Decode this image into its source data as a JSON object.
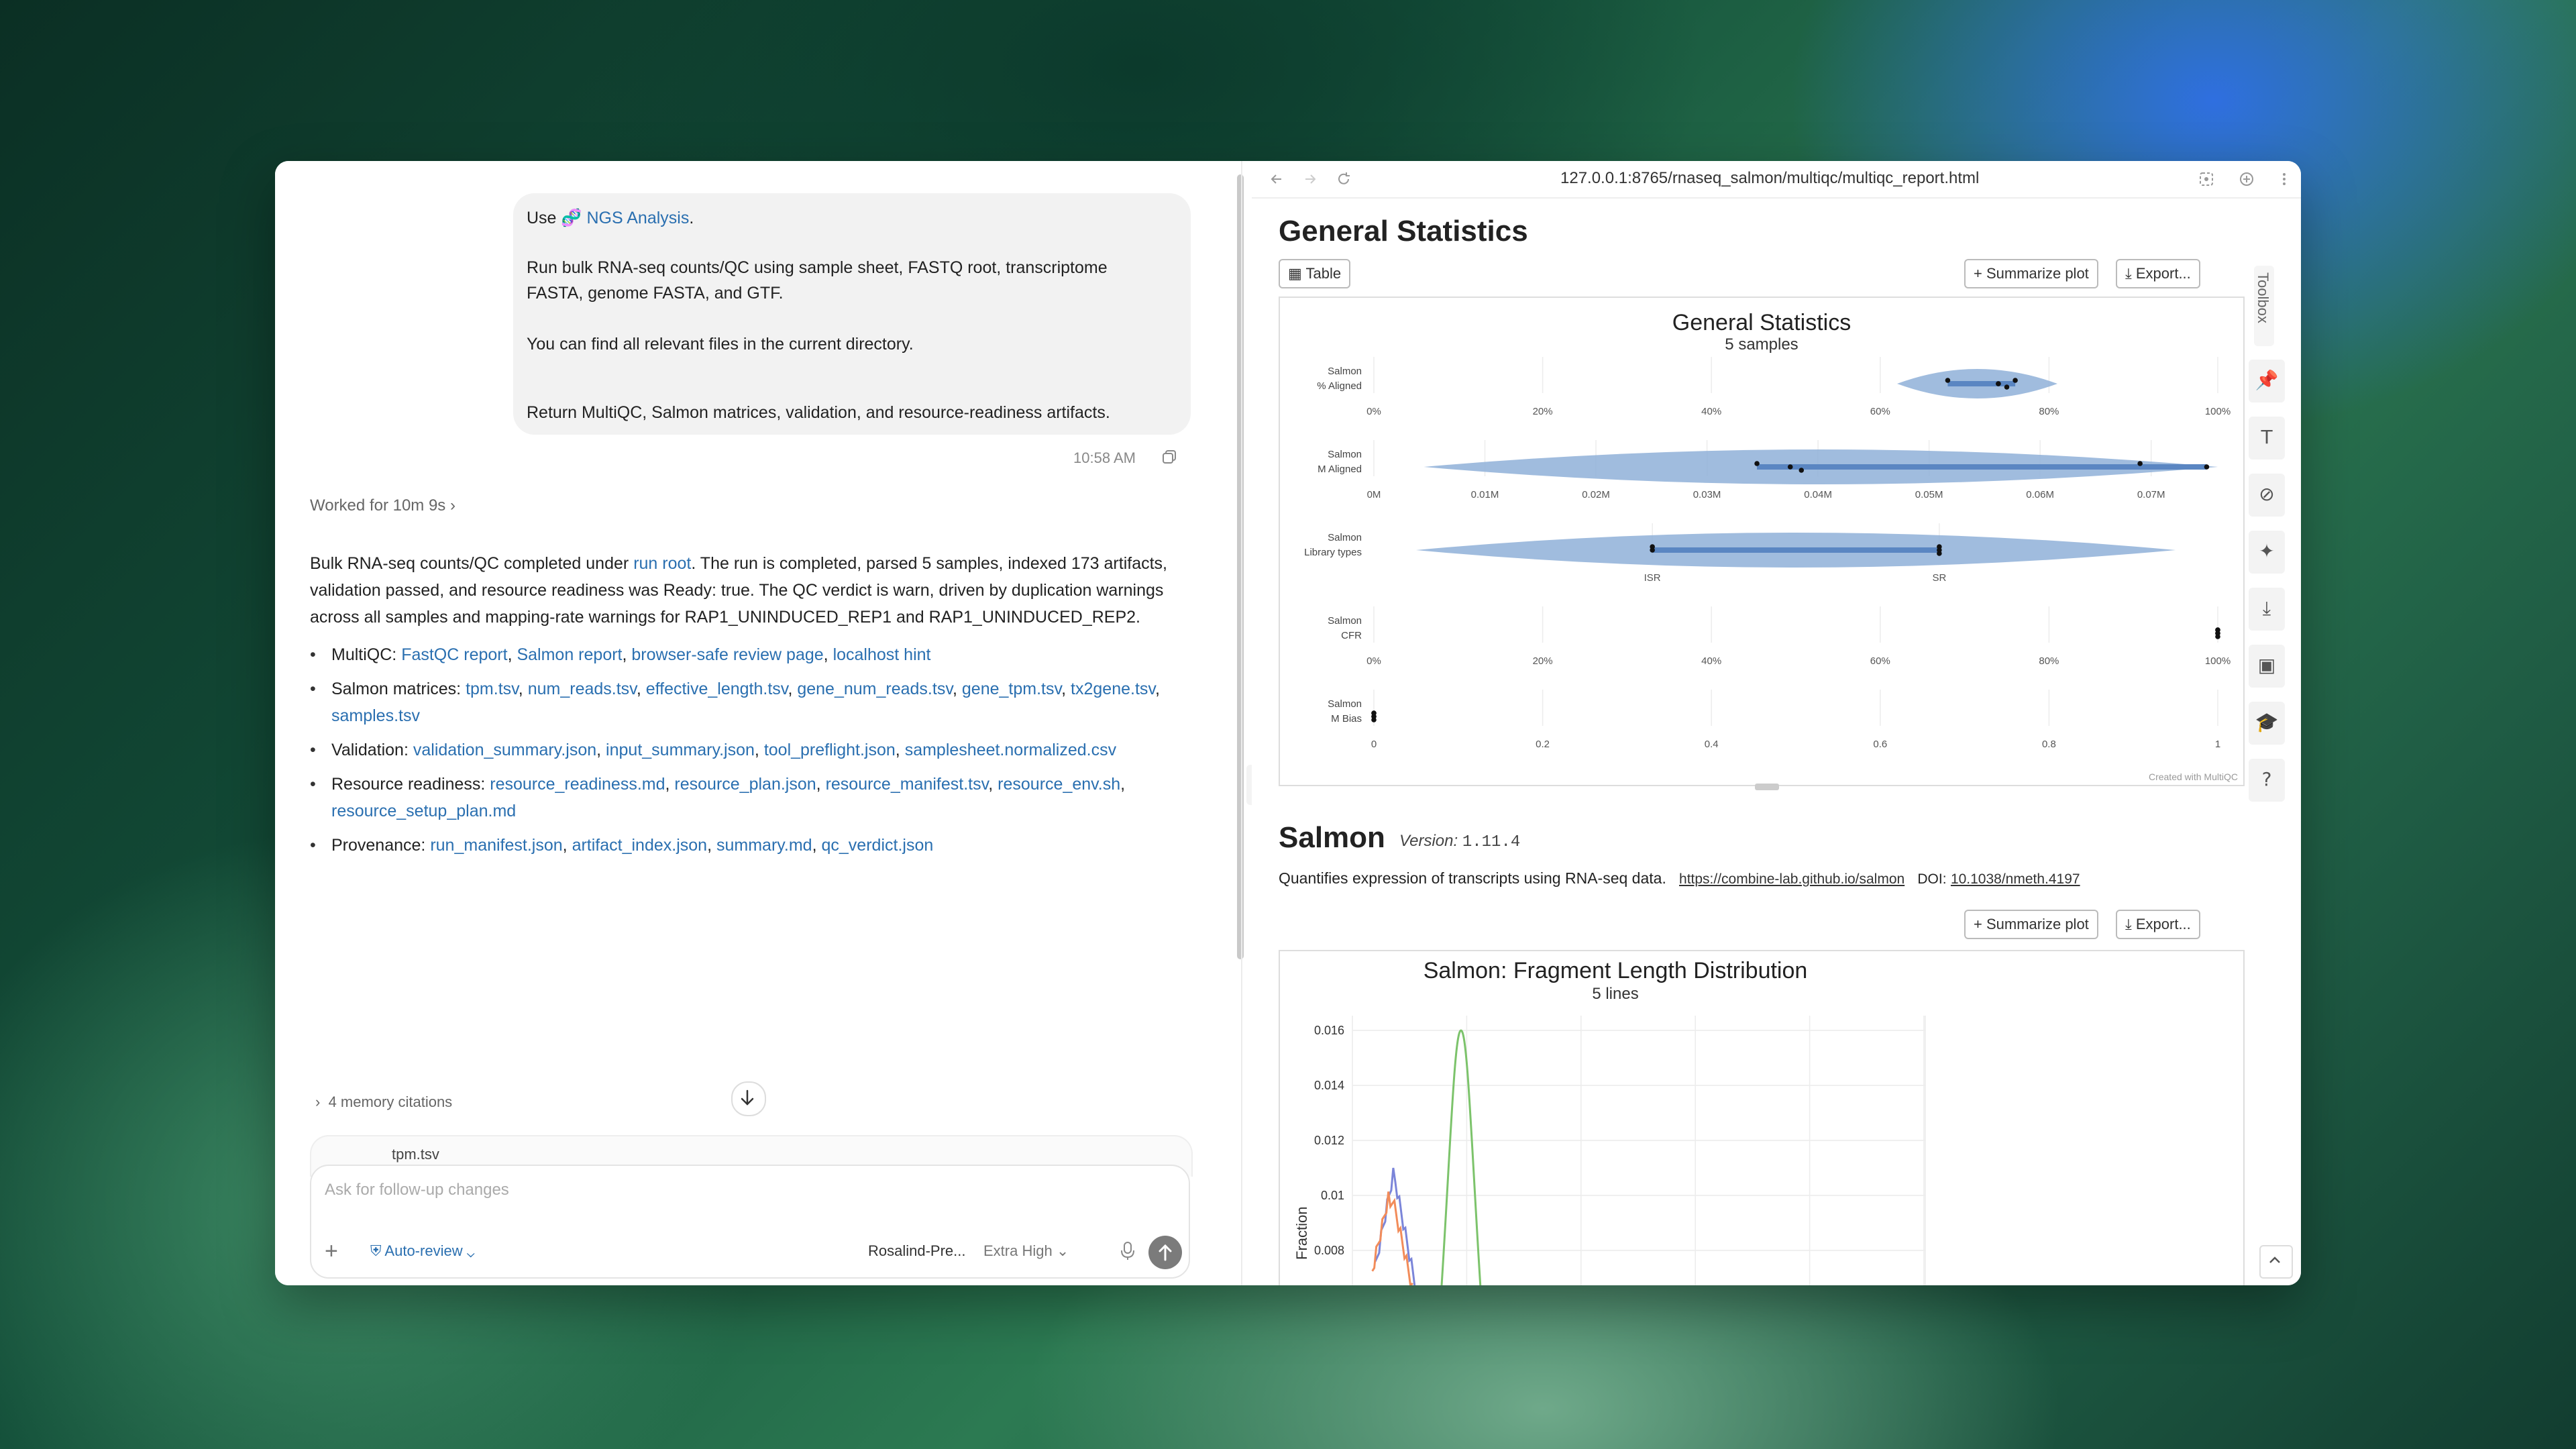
{
  "chat": {
    "user_message": {
      "line1_prefix": "Use",
      "skill_name": "NGS Analysis",
      "line1_suffix": ".",
      "line2": "Run bulk RNA-seq counts/QC using sample sheet, FASTQ root, transcriptome FASTA, genome FASTA, and GTF.",
      "line3": "You can find all relevant files in the current directory.",
      "line4": "Return MultiQC, Salmon matrices, validation, and resource-readiness artifacts.",
      "time": "10:58 AM"
    },
    "worked_for": "Worked for 10m 9s",
    "answer_prefix": "Bulk RNA-seq counts/QC completed under",
    "answer_link": "run root",
    "answer_suffix": ". The run is completed, parsed 5 samples, indexed 173 artifacts, validation passed, and resource readiness was Ready: true. The QC verdict is warn, driven by duplication warnings across all samples and mapping-rate warnings for RAP1_UNINDUCED_REP1 and RAP1_UNINDUCED_REP2.",
    "bullets": [
      {
        "label": "MultiQC:",
        "links": [
          "FastQC report",
          "Salmon report",
          "browser-safe review page",
          "localhost hint"
        ]
      },
      {
        "label": "Salmon matrices:",
        "links": [
          "tpm.tsv",
          "num_reads.tsv",
          "effective_length.tsv",
          "gene_num_reads.tsv",
          "gene_tpm.tsv",
          "tx2gene.tsv",
          "samples.tsv"
        ]
      },
      {
        "label": "Validation:",
        "links": [
          "validation_summary.json",
          "input_summary.json",
          "tool_preflight.json",
          "samplesheet.normalized.csv"
        ]
      },
      {
        "label": "Resource readiness:",
        "links": [
          "resource_readiness.md",
          "resource_plan.json",
          "resource_manifest.tsv",
          "resource_env.sh",
          "resource_setup_plan.md"
        ]
      },
      {
        "label": "Provenance:",
        "links": [
          "run_manifest.json",
          "artifact_index.json",
          "summary.md",
          "qc_verdict.json"
        ]
      }
    ],
    "memory_citations": "4 memory citations",
    "ghost_item": "tpm.tsv",
    "composer": {
      "placeholder": "Ask for follow-up changes",
      "auto_review": "Auto-review",
      "model": "Rosalind-Pre...",
      "effort": "Extra High"
    }
  },
  "browser": {
    "url": "127.0.0.1:8765/rnaseq_salmon/multiqc/multiqc_report.html",
    "general_heading": "General Statistics",
    "table_button": "Table",
    "summarize_button": "+ Summarize plot",
    "export_button": "Export...",
    "toolbox_label": "Toolbox",
    "salmon_heading": "Salmon",
    "salmon_version_label": "Version:",
    "salmon_version": "1.11.4",
    "salmon_desc": "Quantifies expression of transcripts using RNA-seq data.",
    "salmon_url": "https://combine-lab.github.io/salmon",
    "doi_label": "DOI:",
    "doi": "10.1038/nmeth.4197",
    "created_with": "Created with MultiQC"
  },
  "chart_data": [
    {
      "type": "violin",
      "title": "General Statistics",
      "subtitle": "5 samples",
      "rows": [
        {
          "label": [
            "Salmon",
            "% Aligned"
          ],
          "ticks": [
            "0%",
            "20%",
            "40%",
            "60%",
            "80%",
            "100%"
          ],
          "range": [
            0,
            100
          ],
          "points": [
            68,
            74,
            75,
            76,
            74
          ],
          "band": [
            62,
            81
          ]
        },
        {
          "label": [
            "Salmon",
            "M Aligned"
          ],
          "ticks": [
            "0M",
            "0.01M",
            "0.02M",
            "0.03M",
            "0.04M",
            "0.05M",
            "0.06M",
            "0.07M"
          ],
          "range": [
            0,
            0.076
          ],
          "points": [
            0.0345,
            0.0375,
            0.0385,
            0.069,
            0.075
          ],
          "band": [
            0.0045,
            0.076
          ]
        },
        {
          "label": [
            "Salmon",
            "Library types"
          ],
          "ticks": [
            "ISR",
            "SR"
          ],
          "range": [
            0,
            1
          ],
          "points": [
            0.33,
            0.33,
            0.67,
            0.67,
            0.67
          ],
          "band": [
            0.05,
            0.95
          ]
        },
        {
          "label": [
            "Salmon",
            "CFR"
          ],
          "ticks": [
            "0%",
            "20%",
            "40%",
            "60%",
            "80%",
            "100%"
          ],
          "range": [
            0,
            100
          ],
          "points": [
            100,
            100,
            100,
            100,
            100
          ]
        },
        {
          "label": [
            "Salmon",
            "M Bias"
          ],
          "ticks": [
            "0",
            "0.2",
            "0.4",
            "0.6",
            "0.8",
            "1"
          ],
          "range": [
            0,
            1
          ],
          "points": [
            0,
            0,
            0,
            0,
            0
          ]
        }
      ]
    },
    {
      "type": "line",
      "title": "Salmon: Fragment Length Distribution",
      "subtitle": "5 lines",
      "ylabel": "Fraction",
      "yticks": [
        "0.016",
        "0.014",
        "0.012",
        "0.01",
        "0.008"
      ],
      "series": [
        {
          "color": "#7cc36b",
          "peak_x": 0.19,
          "peak_y": 0.016
        },
        {
          "color": "#7b85d9",
          "peak_x": 0.075,
          "peak_y": 0.0105
        },
        {
          "color": "#f28c5a",
          "peak_x": 0.07,
          "peak_y": 0.01
        }
      ]
    }
  ],
  "colors": {
    "link": "#2a6fb0",
    "violin": "#8fb0d8",
    "violin_band": "#5a86c2"
  }
}
